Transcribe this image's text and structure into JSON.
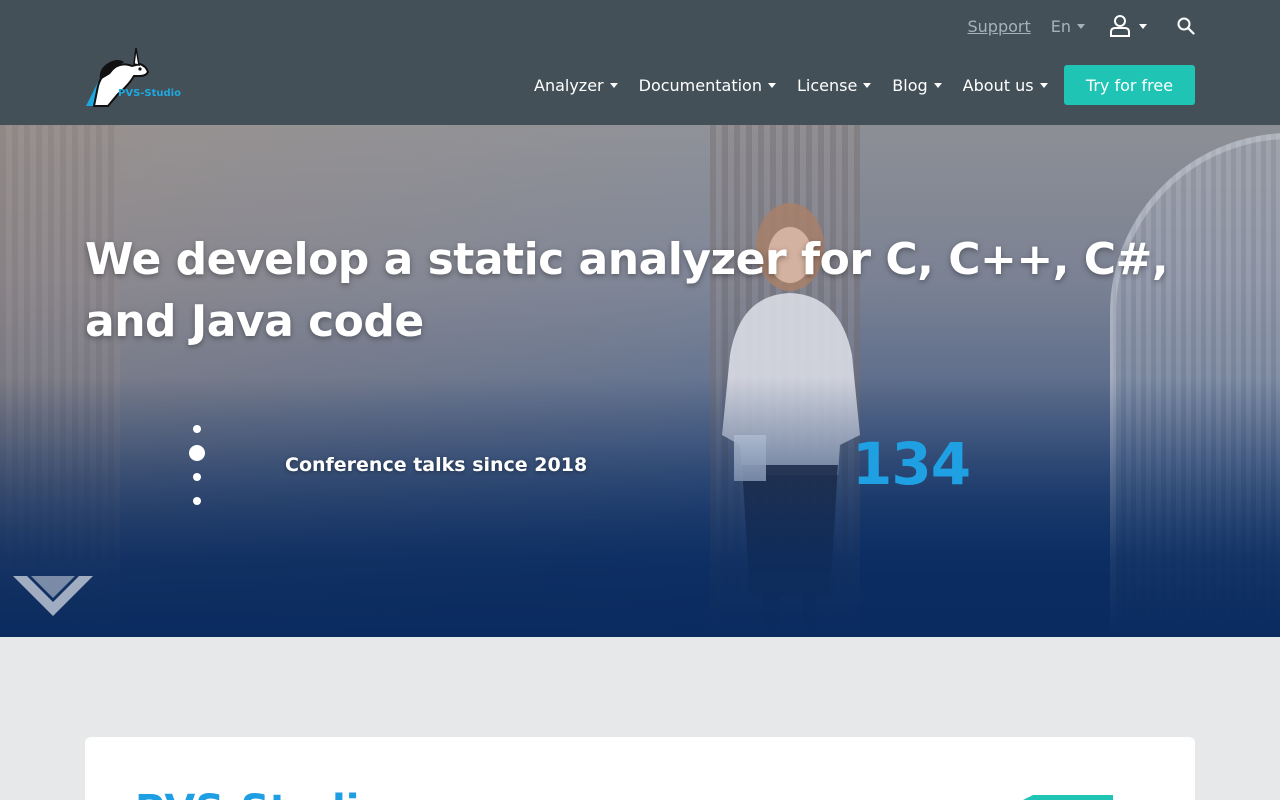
{
  "header": {
    "logo_text": "PVS-Studio",
    "support_label": "Support",
    "language": "En",
    "nav": [
      {
        "label": "Analyzer"
      },
      {
        "label": "Documentation"
      },
      {
        "label": "License"
      },
      {
        "label": "Blog"
      },
      {
        "label": "About us"
      }
    ],
    "cta_label": "Try for free",
    "icons": {
      "account": "user-icon",
      "search": "search-icon"
    }
  },
  "hero": {
    "headline": "We develop a static analyzer for C, C++, C#, and Java code",
    "stat_label": "Conference talks since 2018",
    "stat_value": "134",
    "slider_active_index": 1,
    "slider_count": 4
  },
  "content": {
    "card_title": "PVS-Studio"
  },
  "colors": {
    "header_bg": "#435058",
    "cta": "#1fc4b4",
    "accent_blue": "#1fa0e3",
    "page_bg": "#e7e8ea"
  }
}
